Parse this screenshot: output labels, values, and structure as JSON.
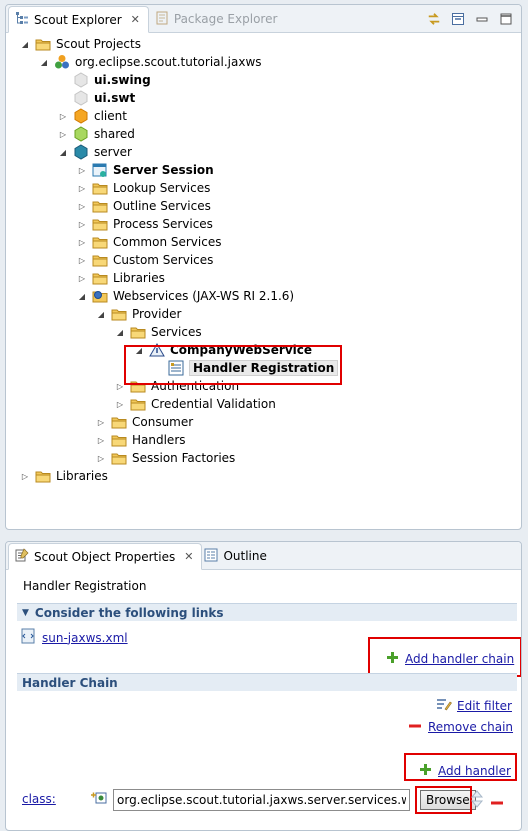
{
  "top_panel": {
    "tabs": [
      {
        "label": "Scout Explorer",
        "active": true
      },
      {
        "label": "Package Explorer",
        "active": false
      }
    ],
    "tree": [
      {
        "label": "Scout Projects",
        "bold": false,
        "icon": "folder-icon"
      },
      {
        "label": "org.eclipse.scout.tutorial.jaxws",
        "bold": false,
        "icon": "project-icon"
      },
      {
        "label": "ui.swing",
        "bold": true,
        "icon": "ui-swing-icon"
      },
      {
        "label": "ui.swt",
        "bold": true,
        "icon": "ui-swt-icon"
      },
      {
        "label": "client",
        "bold": false,
        "icon": "client-bundle-icon"
      },
      {
        "label": "shared",
        "bold": false,
        "icon": "shared-bundle-icon"
      },
      {
        "label": "server",
        "bold": false,
        "icon": "server-bundle-icon"
      },
      {
        "label": "Server Session",
        "bold": true,
        "icon": "session-icon"
      },
      {
        "label": "Lookup Services",
        "bold": false,
        "icon": "folder-icon"
      },
      {
        "label": "Outline Services",
        "bold": false,
        "icon": "folder-icon"
      },
      {
        "label": "Process Services",
        "bold": false,
        "icon": "folder-icon"
      },
      {
        "label": "Common Services",
        "bold": false,
        "icon": "folder-icon"
      },
      {
        "label": "Custom Services",
        "bold": false,
        "icon": "folder-icon"
      },
      {
        "label": "Libraries",
        "bold": false,
        "icon": "folder-icon"
      },
      {
        "label": "Webservices (JAX-WS RI 2.1.6)",
        "bold": false,
        "icon": "webservice-folder-icon"
      },
      {
        "label": "Provider",
        "bold": false,
        "icon": "folder-icon"
      },
      {
        "label": "Services",
        "bold": false,
        "icon": "folder-icon"
      },
      {
        "label": "CompanyWebService",
        "bold": true,
        "icon": "webservice-icon"
      },
      {
        "label": "Handler Registration",
        "bold": true,
        "icon": "handler-icon"
      },
      {
        "label": "Authentication",
        "bold": false,
        "icon": "folder-icon"
      },
      {
        "label": "Credential Validation",
        "bold": false,
        "icon": "folder-icon"
      },
      {
        "label": "Consumer",
        "bold": false,
        "icon": "folder-icon"
      },
      {
        "label": "Handlers",
        "bold": false,
        "icon": "folder-icon"
      },
      {
        "label": "Session Factories",
        "bold": false,
        "icon": "folder-icon"
      },
      {
        "label": "Libraries",
        "bold": false,
        "icon": "folder-icon"
      }
    ]
  },
  "bottom_panel": {
    "tabs": [
      {
        "label": "Scout Object Properties",
        "active": true
      },
      {
        "label": "Outline",
        "active": false
      }
    ],
    "title": "Handler Registration",
    "links_section": {
      "heading": "Consider the following links",
      "link": "sun-jaxws.xml",
      "add_handler_chain": "Add handler chain"
    },
    "chain_section": {
      "heading": "Handler Chain",
      "edit_filter": "Edit filter",
      "remove_chain": "Remove chain",
      "add_handler": "Add handler",
      "class_label": "class:",
      "class_value": "org.eclipse.scout.tutorial.jaxws.server.services.ws.handle",
      "browse": "Browse"
    }
  },
  "colors": {
    "highlight_box": "#e00000",
    "link": "#1a1aa6",
    "section_heading": "#2c4f7c"
  }
}
